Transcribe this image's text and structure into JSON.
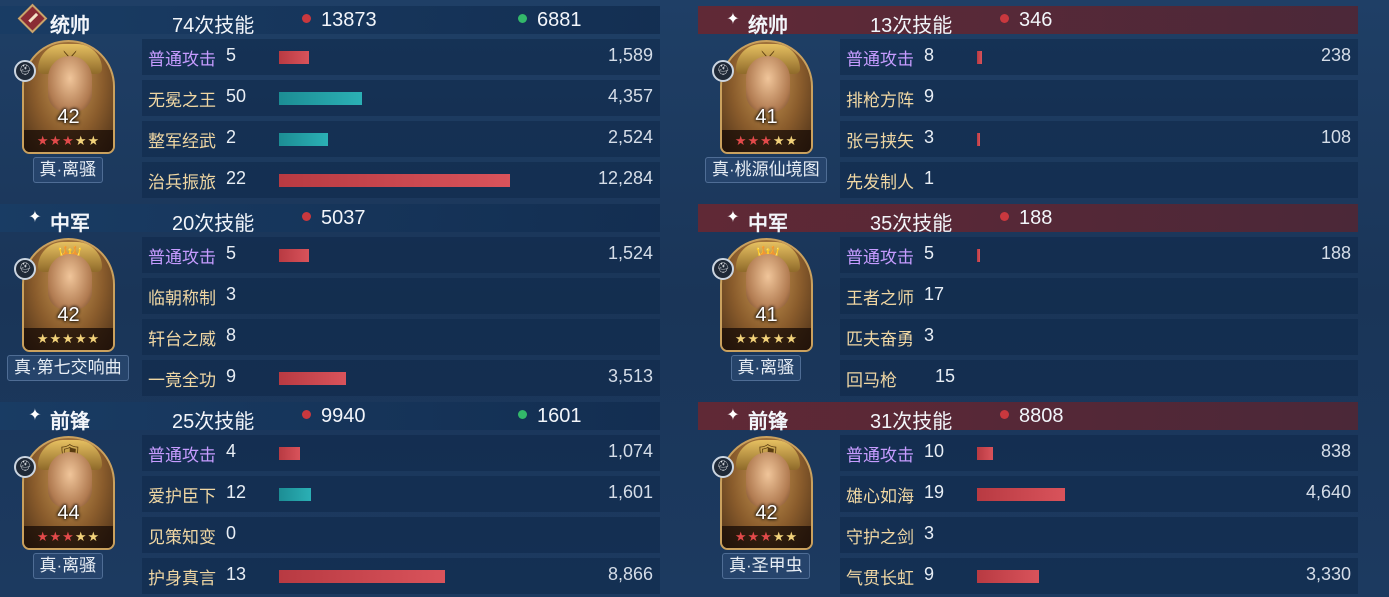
{
  "left": {
    "sections": [
      {
        "role": "统帅",
        "skills": "74次技能",
        "red_stat": "13873",
        "green_stat": "6881",
        "level": "42",
        "tag": "真·离骚",
        "skill_rows": [
          {
            "name": "普通攻击",
            "count": "5",
            "value": "1,589",
            "bar_ratio": 0.13,
            "bar_color": "red",
            "normal": true
          },
          {
            "name": "无冕之王",
            "count": "50",
            "value": "4,357",
            "bar_ratio": 0.36,
            "bar_color": "teal",
            "normal": false
          },
          {
            "name": "整军经武",
            "count": "2",
            "value": "2,524",
            "bar_ratio": 0.21,
            "bar_color": "teal",
            "normal": false
          },
          {
            "name": "治兵振旅",
            "count": "22",
            "value": "12,284",
            "bar_ratio": 1.0,
            "bar_color": "red",
            "normal": false
          }
        ]
      },
      {
        "role": "中军",
        "skills": "20次技能",
        "red_stat": "5037",
        "green_stat": "",
        "level": "42",
        "tag": "真·第七交响曲",
        "skill_rows": [
          {
            "name": "普通攻击",
            "count": "5",
            "value": "1,524",
            "bar_ratio": 0.13,
            "bar_color": "red",
            "normal": true
          },
          {
            "name": "临朝称制",
            "count": "3",
            "value": "",
            "bar_ratio": 0,
            "bar_color": "red",
            "normal": false
          },
          {
            "name": "轩台之威",
            "count": "8",
            "value": "",
            "bar_ratio": 0,
            "bar_color": "red",
            "normal": false
          },
          {
            "name": "一竟全功",
            "count": "9",
            "value": "3,513",
            "bar_ratio": 0.29,
            "bar_color": "red",
            "normal": false
          }
        ]
      },
      {
        "role": "前锋",
        "skills": "25次技能",
        "red_stat": "9940",
        "green_stat": "1601",
        "level": "44",
        "tag": "真·离骚",
        "skill_rows": [
          {
            "name": "普通攻击",
            "count": "4",
            "value": "1,074",
            "bar_ratio": 0.09,
            "bar_color": "red",
            "normal": true
          },
          {
            "name": "爱护臣下",
            "count": "12",
            "value": "1,601",
            "bar_ratio": 0.14,
            "bar_color": "teal",
            "normal": false
          },
          {
            "name": "见策知变",
            "count": "0",
            "value": "",
            "bar_ratio": 0,
            "bar_color": "red",
            "normal": false
          },
          {
            "name": "护身真言",
            "count": "13",
            "value": "8,866",
            "bar_ratio": 0.72,
            "bar_color": "red",
            "normal": false
          }
        ]
      }
    ]
  },
  "right": {
    "sections": [
      {
        "role": "统帅",
        "skills": "13次技能",
        "red_stat": "346",
        "green_stat": "",
        "level": "41",
        "tag": "真·桃源仙境图",
        "skill_rows": [
          {
            "name": "普通攻击",
            "count": "8",
            "value": "238",
            "bar_ratio": 0.02,
            "bar_color": "red",
            "normal": true
          },
          {
            "name": "排枪方阵",
            "count": "9",
            "value": "",
            "bar_ratio": 0,
            "bar_color": "red",
            "normal": false
          },
          {
            "name": "张弓挟矢",
            "count": "3",
            "value": "108",
            "bar_ratio": 0.005,
            "bar_color": "red",
            "normal": false
          },
          {
            "name": "先发制人",
            "count": "1",
            "value": "",
            "bar_ratio": 0,
            "bar_color": "red",
            "normal": false
          }
        ]
      },
      {
        "role": "中军",
        "skills": "35次技能",
        "red_stat": "188",
        "green_stat": "",
        "level": "41",
        "tag": "真·离骚",
        "skill_rows": [
          {
            "name": "普通攻击",
            "count": "5",
            "value": "188",
            "bar_ratio": 0.015,
            "bar_color": "red",
            "normal": true
          },
          {
            "name": "王者之师",
            "count": "17",
            "value": "",
            "bar_ratio": 0,
            "bar_color": "red",
            "normal": false
          },
          {
            "name": "匹夫奋勇",
            "count": "3",
            "value": "",
            "bar_ratio": 0,
            "bar_color": "red",
            "normal": false
          },
          {
            "name": "回马枪",
            "count": "15",
            "value": "",
            "bar_ratio": 0,
            "bar_color": "red",
            "normal": false
          }
        ]
      },
      {
        "role": "前锋",
        "skills": "31次技能",
        "red_stat": "8808",
        "green_stat": "",
        "level": "42",
        "tag": "真·圣甲虫",
        "skill_rows": [
          {
            "name": "普通攻击",
            "count": "10",
            "value": "838",
            "bar_ratio": 0.07,
            "bar_color": "red",
            "normal": true
          },
          {
            "name": "雄心如海",
            "count": "19",
            "value": "4,640",
            "bar_ratio": 0.38,
            "bar_color": "red",
            "normal": false
          },
          {
            "name": "守护之剑",
            "count": "3",
            "value": "",
            "bar_ratio": 0,
            "bar_color": "red",
            "normal": false
          },
          {
            "name": "气贯长虹",
            "count": "9",
            "value": "3,330",
            "bar_ratio": 0.27,
            "bar_color": "red",
            "normal": false
          }
        ]
      }
    ]
  },
  "colors": {
    "accent_red": "#c9383e",
    "accent_green": "#33b86a",
    "skill_gold": "#f0d7a3",
    "normal_attack_purple": "#c69cff"
  },
  "icons": {
    "role_commander_left": "diamond-emblem-icon",
    "role_other": "sparkle-icon",
    "portrait_badge": "helmet-badge-icon"
  }
}
